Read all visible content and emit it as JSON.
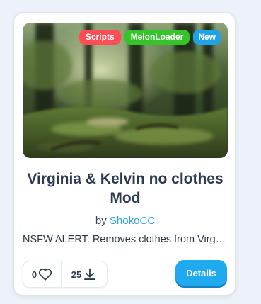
{
  "colors": {
    "scripts_badge": "#ff4d55",
    "loader_badge": "#35c42a",
    "new_badge": "#1fa3e8",
    "author_link": "#27a3e6",
    "details_button": "#1faaf0"
  },
  "mod_card": {
    "thumbnail_icon": "forest-image",
    "badges": {
      "scripts": "Scripts",
      "loader": "MelonLoader",
      "new": "New"
    },
    "title": "Virginia & Kelvin no clothes Mod",
    "by_label": "by",
    "author": "ShokoCC",
    "description": "NSFW ALERT: Removes clothes from Virginia and Kelvin",
    "likes": "0",
    "like_icon": "heart-icon",
    "downloads": "25",
    "download_icon": "download-icon",
    "details_label": "Details"
  }
}
